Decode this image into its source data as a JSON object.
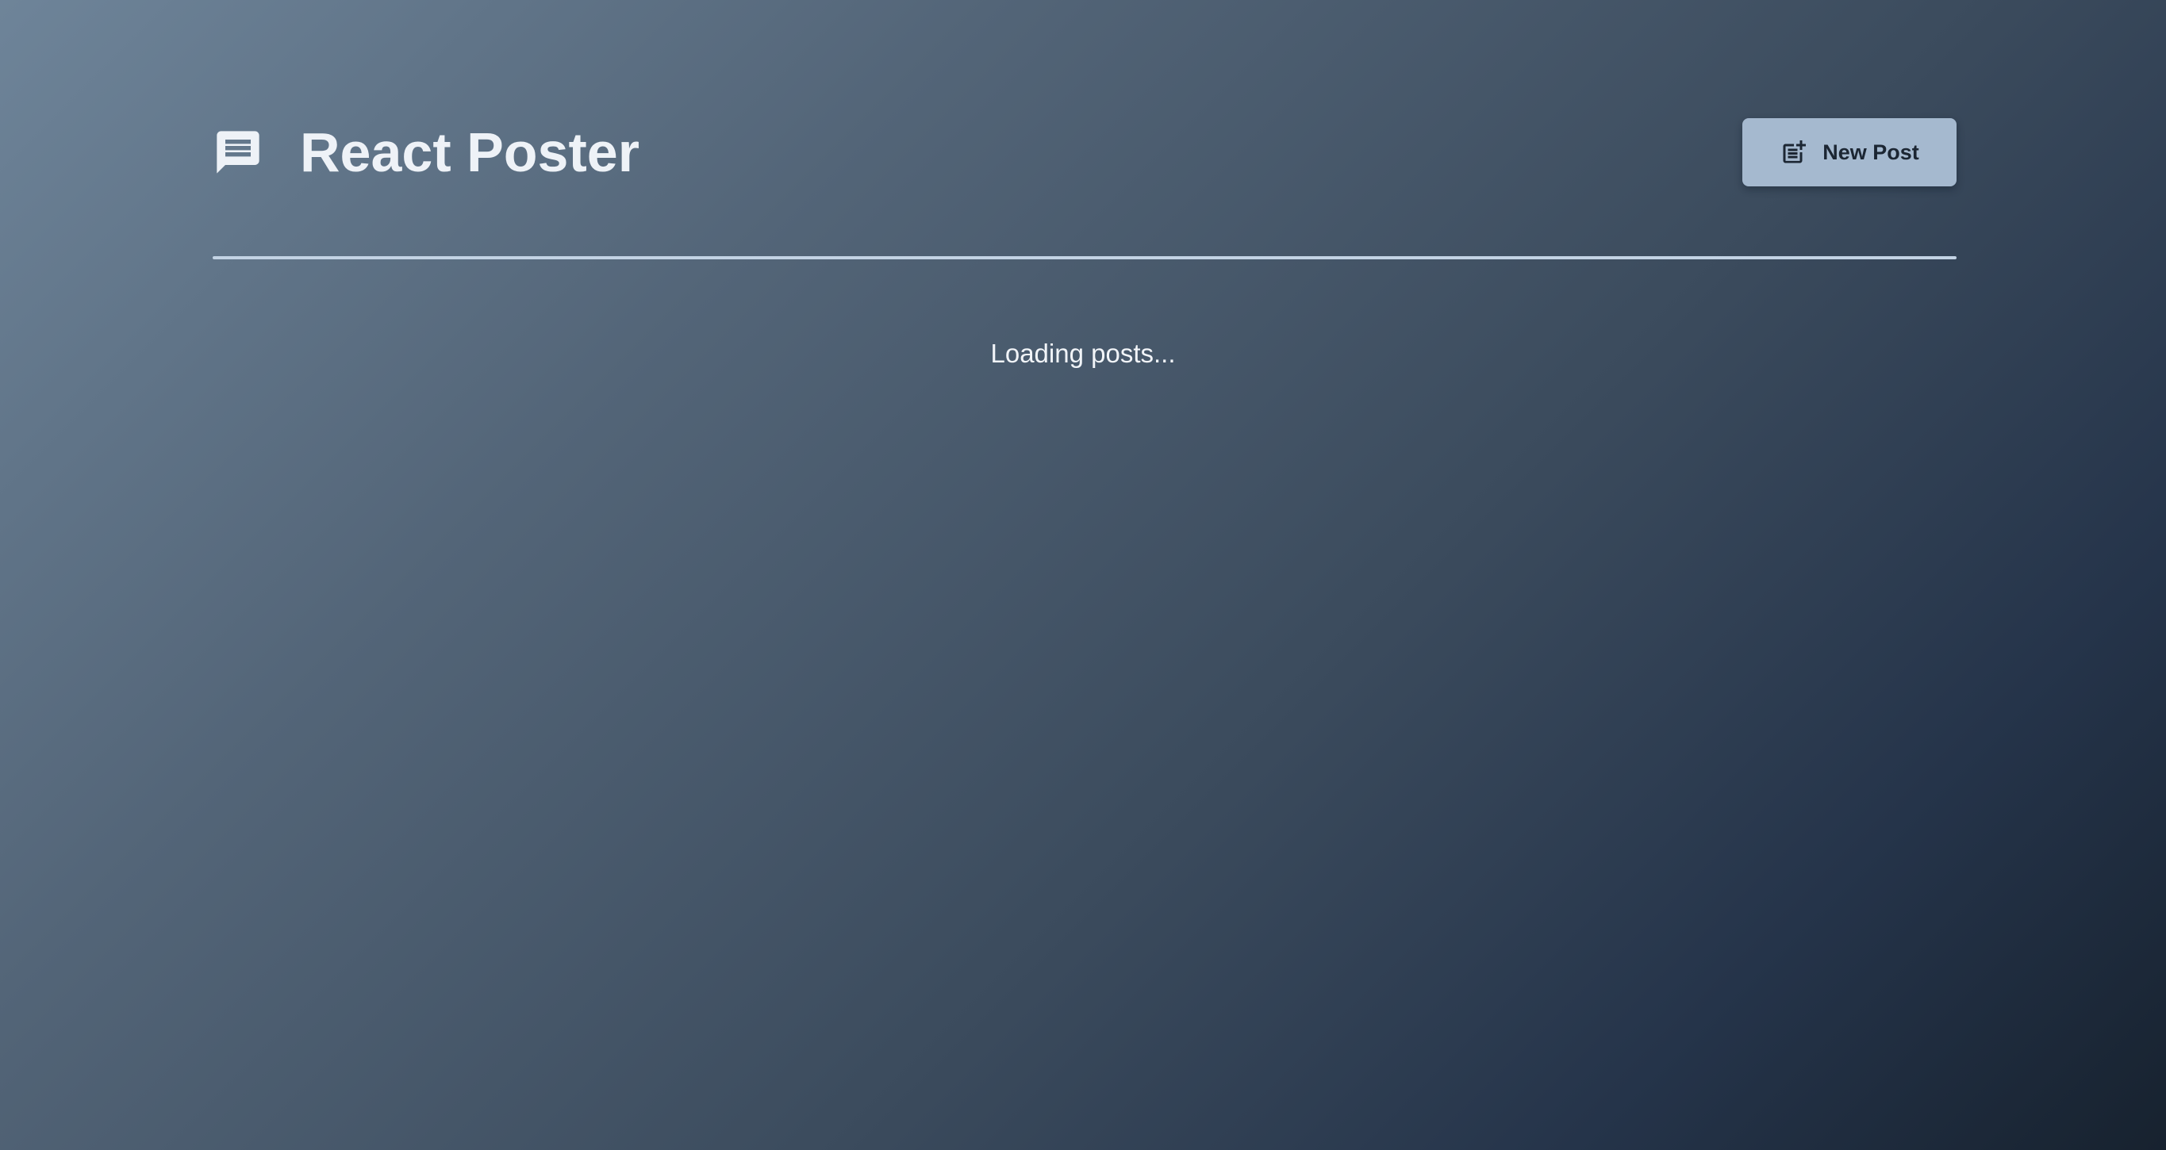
{
  "header": {
    "title": "React Poster",
    "logo_icon": "message-icon",
    "new_post_label": "New Post",
    "new_post_icon": "post-add-icon"
  },
  "main": {
    "status_text": "Loading posts..."
  },
  "colors": {
    "background_light": "#6e8499",
    "background_dark": "#17222f",
    "button_bg": "#a5b9cf",
    "divider": "#c3d3e4",
    "title_text": "#eef2f7"
  }
}
